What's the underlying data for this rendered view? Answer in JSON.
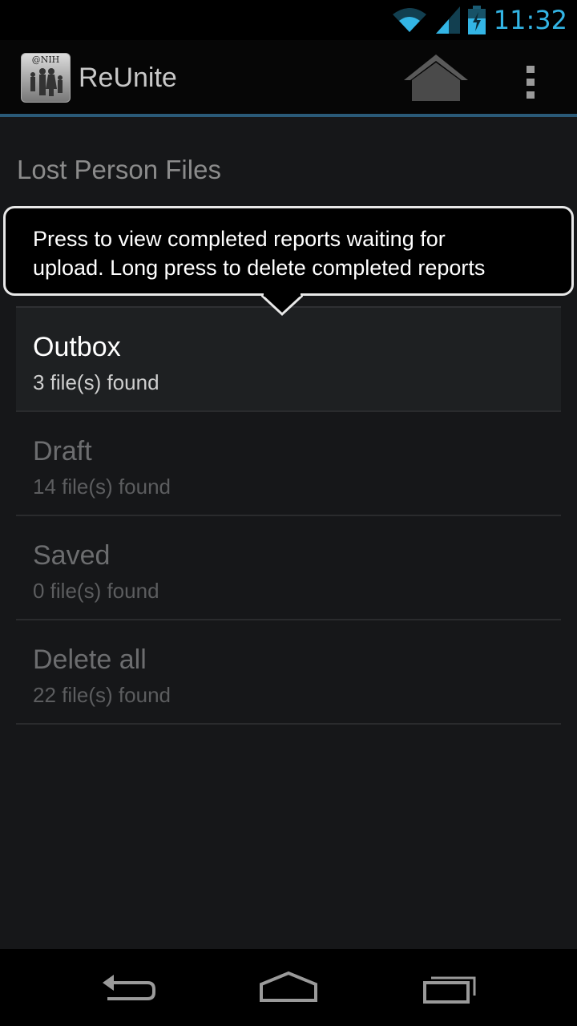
{
  "status_bar": {
    "time": "11:32",
    "icons": [
      "wifi-icon",
      "signal-icon",
      "battery-charging-icon"
    ]
  },
  "action_bar": {
    "app_icon_label": "@NIH",
    "app_title": "ReUnite",
    "icons": [
      "home-icon",
      "overflow-menu-icon"
    ]
  },
  "section_title": "Lost Person Files",
  "tooltip": {
    "line1": "Press to view completed reports waiting for",
    "line2": "upload.  Long press to delete completed reports"
  },
  "list": {
    "items": [
      {
        "title": "Outbox",
        "subtitle": "3 file(s) found"
      },
      {
        "title": "Draft",
        "subtitle": "14 file(s) found"
      },
      {
        "title": "Saved",
        "subtitle": "0 file(s) found"
      },
      {
        "title": "Delete all",
        "subtitle": "22 file(s) found"
      }
    ]
  },
  "nav_bar": {
    "icons": [
      "back-icon",
      "home-nav-icon",
      "recent-apps-icon"
    ]
  },
  "colors": {
    "accent": "#33b5e5",
    "divider": "#2a5a78",
    "background": "#161719"
  }
}
